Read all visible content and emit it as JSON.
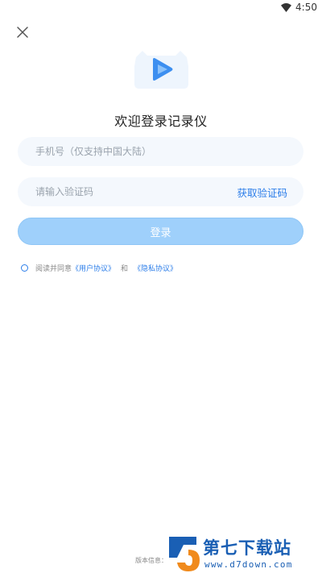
{
  "status_bar": {
    "time": "4:50",
    "wifi_icon": "wifi-icon"
  },
  "header": {
    "close_icon": "close-icon"
  },
  "app": {
    "title": "欢迎登录记录仪",
    "logo_icon": "play-logo-icon"
  },
  "form": {
    "phone_placeholder": "手机号（仅支持中国大陆）",
    "phone_value": "",
    "code_placeholder": "请输入验证码",
    "code_value": "",
    "get_code_label": "获取验证码",
    "login_label": "登录"
  },
  "agreement": {
    "prefix": "阅读并同意",
    "user_agreement": "《用户协议》",
    "and": "和",
    "privacy_policy": "《隐私协议》"
  },
  "footer": {
    "version_label": "版本信息："
  },
  "watermark": {
    "title": "第七下载站",
    "url": "www.d7down.com"
  },
  "colors": {
    "accent": "#2b7de9",
    "button_disabled": "#9fd0fb",
    "field_bg": "#f4f8fd"
  }
}
